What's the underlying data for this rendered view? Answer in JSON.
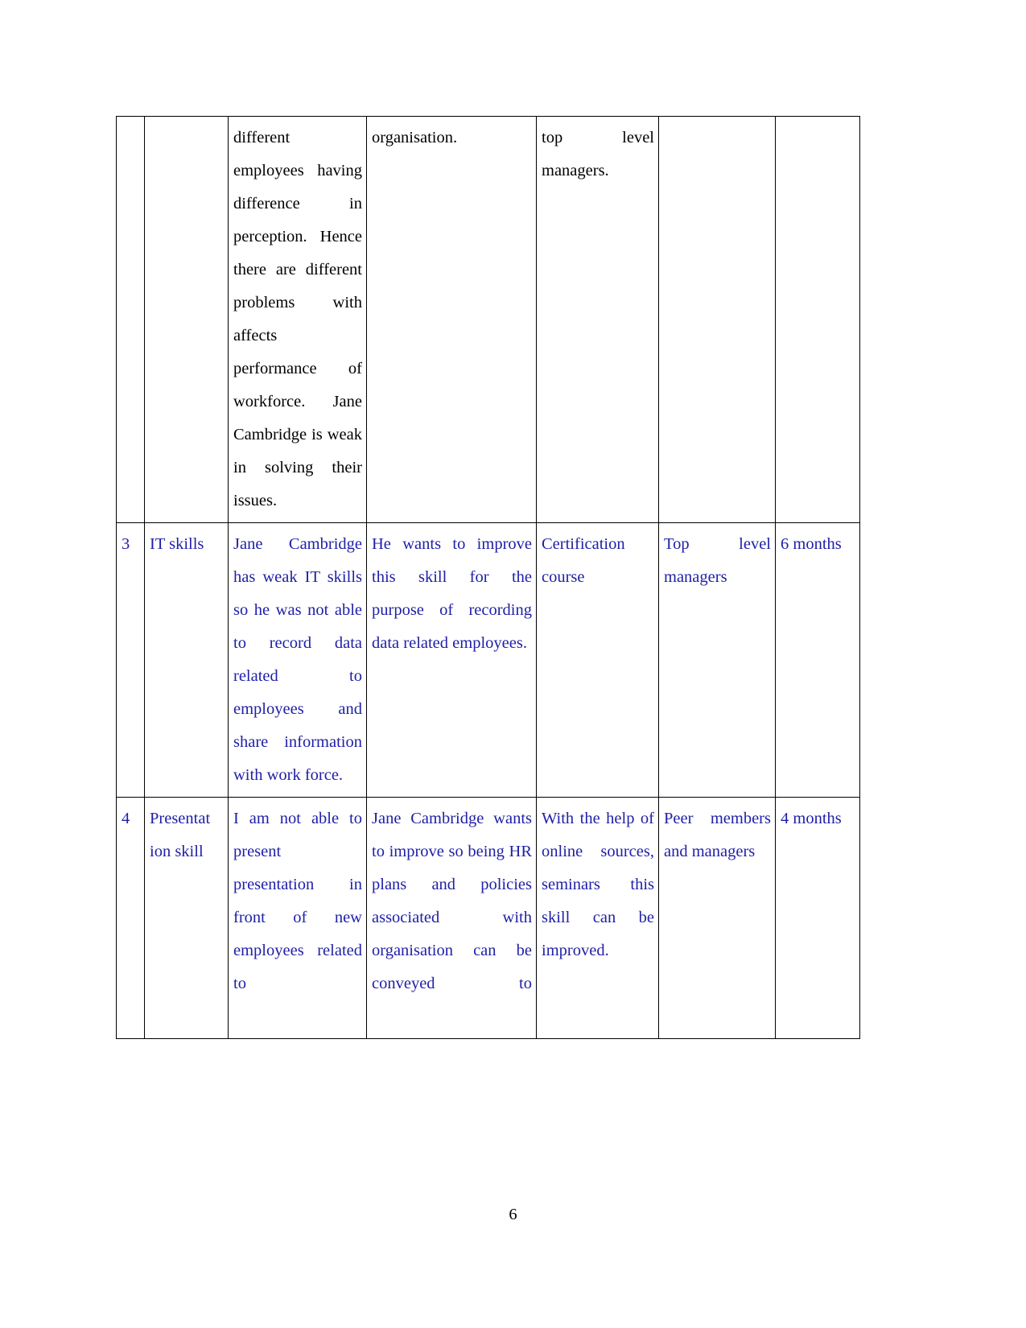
{
  "document": {
    "page_number": "6",
    "text_colors": {
      "black": "#000000",
      "blue": "#2020a8",
      "border": "#000000",
      "background": "#ffffff"
    }
  },
  "table": {
    "columns": [
      "sn",
      "skill_area",
      "current_proficiency",
      "target_proficiency",
      "development_opportunity",
      "criteria_judging_success",
      "time_scale"
    ],
    "rows": [
      {
        "sn": "",
        "skill_area": "",
        "current_proficiency": "different employees having difference in perception. Hence there are different problems with affects performance of workforce. Jane Cambridge is weak in solving their issues.",
        "target_proficiency": "organisation.",
        "development_opportunity": "top level managers.",
        "criteria_judging_success": "",
        "time_scale": "",
        "color": "black",
        "continued": true
      },
      {
        "sn": "3",
        "skill_area": "IT skills",
        "current_proficiency": "Jane Cambridge has weak IT skills so he was not able to record data related to employees and share information with work force.",
        "target_proficiency": "He wants to improve this skill for the purpose of recording data related employees.",
        "development_opportunity": "Certification course",
        "criteria_judging_success": "Top level managers",
        "time_scale": "6 months",
        "color": "blue",
        "continued": false
      },
      {
        "sn": "4",
        "skill_area": "Presentat ion skill",
        "current_proficiency": "I am not able to present presentation in front of new employees related to",
        "target_proficiency": "Jane Cambridge wants to improve so being HR plans and policies associated with organisation can be conveyed to",
        "development_opportunity": "With the help of online sources, seminars this skill can be improved.",
        "criteria_judging_success": "Peer members and managers",
        "time_scale": "4 months",
        "color": "blue",
        "continued": false
      }
    ]
  }
}
